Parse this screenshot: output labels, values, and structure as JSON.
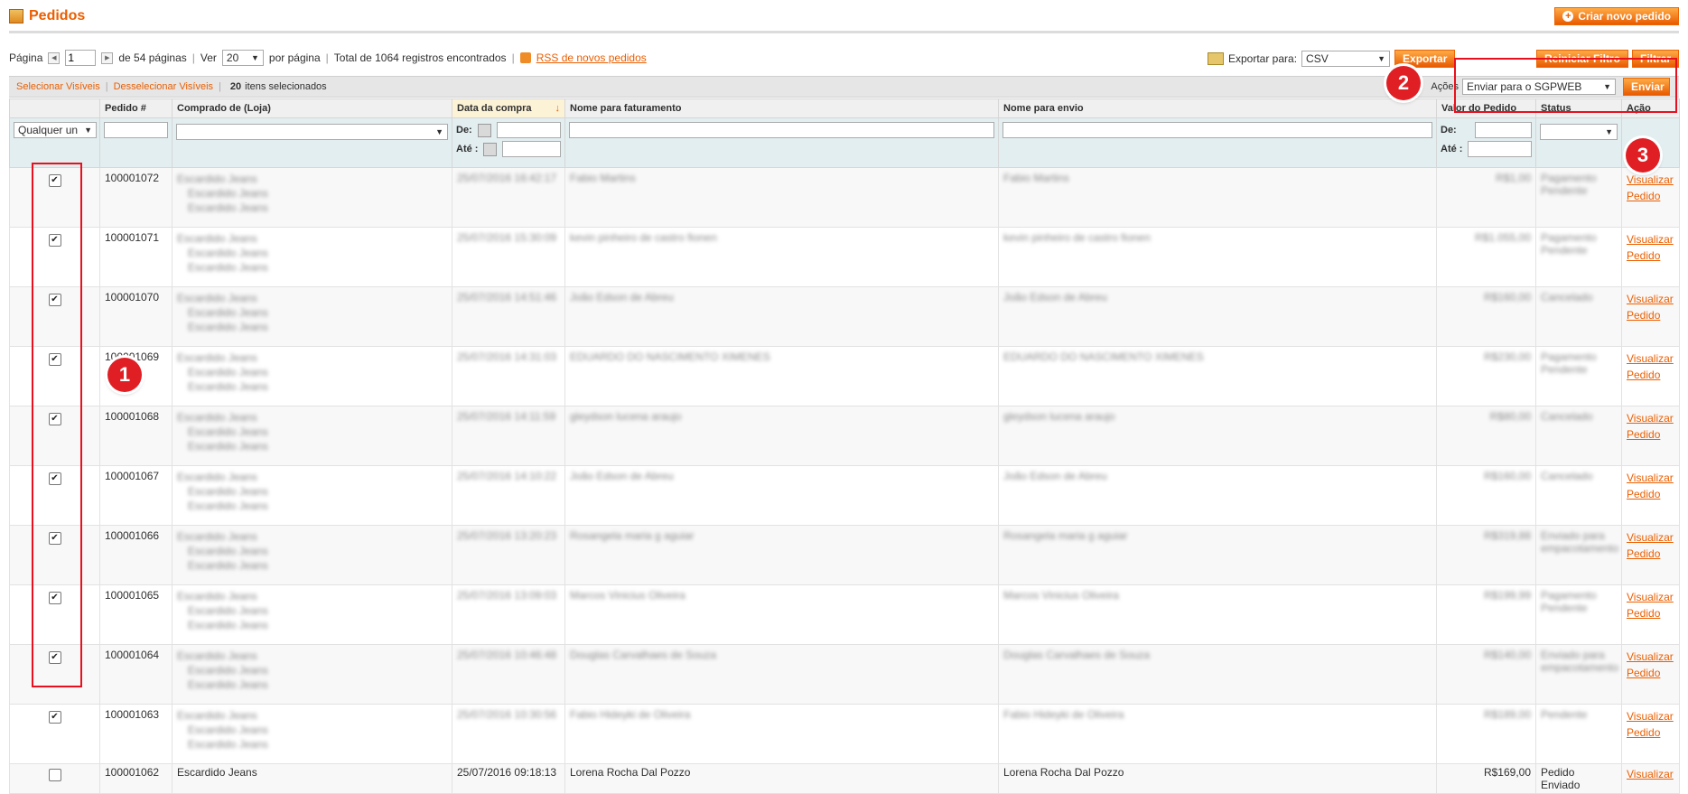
{
  "header": {
    "title": "Pedidos",
    "create_order": "Criar novo pedido"
  },
  "pager": {
    "page_label": "Página",
    "page_value": "1",
    "total_pages": "de 54 páginas",
    "view_label": "Ver",
    "per_page": "20",
    "per_page_suffix": "por página",
    "total": "Total de 1064 registros encontrados",
    "rss": "RSS de novos pedidos"
  },
  "export": {
    "label": "Exportar para:",
    "format": "CSV",
    "button": "Exportar"
  },
  "filters_buttons": {
    "reset": "Reiniciar Filtro",
    "search": "Filtrar"
  },
  "massaction": {
    "select_visible": "Selecionar Visíveis",
    "deselect_visible": "Desselecionar Visíveis",
    "selected_count": "20",
    "selected_suffix": "itens selecionados",
    "actions_label": "Ações",
    "action_value": "Enviar para o SGPWEB",
    "submit": "Enviar"
  },
  "columns": [
    "Pedido #",
    "Comprado de (Loja)",
    "Data da compra",
    "Nome para faturamento",
    "Nome para envio",
    "Valor do Pedido",
    "Status",
    "Ação"
  ],
  "filters": {
    "any": "Qualquer un",
    "from": "De:",
    "to": "Até :"
  },
  "badges": [
    "1",
    "2",
    "3"
  ],
  "rows": [
    {
      "id": "100001072",
      "store": [
        "Escardido Jeans",
        "Escardido Jeans",
        "Escardido Jeans"
      ],
      "date": "25/07/2016 16:42:17",
      "bill": "Fabio Martins",
      "ship": "Fabio Martins",
      "value": "R$1,00",
      "status": "Pagamento Pendente",
      "action": [
        "Visualizar",
        "Pedido"
      ]
    },
    {
      "id": "100001071",
      "store": [
        "Escardido Jeans",
        "Escardido Jeans",
        "Escardido Jeans"
      ],
      "date": "25/07/2016 15:30:09",
      "bill": "kevin pinheiro de castro fionen",
      "ship": "kevin pinheiro de castro fionen",
      "value": "R$1.055,00",
      "status": "Pagamento Pendente",
      "action": [
        "Visualizar",
        "Pedido"
      ]
    },
    {
      "id": "100001070",
      "store": [
        "Escardido Jeans",
        "Escardido Jeans",
        "Escardido Jeans"
      ],
      "date": "25/07/2016 14:51:46",
      "bill": "João Edson de Abreu",
      "ship": "João Edson de Abreu",
      "value": "R$160,00",
      "status": "Cancelado",
      "action": [
        "Visualizar",
        "Pedido"
      ]
    },
    {
      "id": "100001069",
      "store": [
        "Escardido Jeans",
        "Escardido Jeans",
        "Escardido Jeans"
      ],
      "date": "25/07/2016 14:31:03",
      "bill": "EDUARDO DO NASCIMENTO XIMENES",
      "ship": "EDUARDO DO NASCIMENTO XIMENES",
      "value": "R$230,00",
      "status": "Pagamento Pendente",
      "action": [
        "Visualizar",
        "Pedido"
      ]
    },
    {
      "id": "100001068",
      "store": [
        "Escardido Jeans",
        "Escardido Jeans",
        "Escardido Jeans"
      ],
      "date": "25/07/2016 14:11:59",
      "bill": "gleydson lucena araujo",
      "ship": "gleydson lucena araujo",
      "value": "R$80,00",
      "status": "Cancelado",
      "action": [
        "Visualizar",
        "Pedido"
      ]
    },
    {
      "id": "100001067",
      "store": [
        "Escardido Jeans",
        "Escardido Jeans",
        "Escardido Jeans"
      ],
      "date": "25/07/2016 14:10:22",
      "bill": "João Edson de Abreu",
      "ship": "João Edson de Abreu",
      "value": "R$160,00",
      "status": "Cancelado",
      "action": [
        "Visualizar",
        "Pedido"
      ]
    },
    {
      "id": "100001066",
      "store": [
        "Escardido Jeans",
        "Escardido Jeans",
        "Escardido Jeans"
      ],
      "date": "25/07/2016 13:20:23",
      "bill": "Rosangela maria g aguiar",
      "ship": "Rosangela maria g aguiar",
      "value": "R$319,88",
      "status": "Enviado para empacotamento",
      "action": [
        "Visualizar",
        "Pedido"
      ]
    },
    {
      "id": "100001065",
      "store": [
        "Escardido Jeans",
        "Escardido Jeans",
        "Escardido Jeans"
      ],
      "date": "25/07/2016 13:09:03",
      "bill": "Marcos Vinicius Oliveira",
      "ship": "Marcos Vinicius Oliveira",
      "value": "R$199,99",
      "status": "Pagamento Pendente",
      "action": [
        "Visualizar",
        "Pedido"
      ]
    },
    {
      "id": "100001064",
      "store": [
        "Escardido Jeans",
        "Escardido Jeans",
        "Escardido Jeans"
      ],
      "date": "25/07/2016 10:46:48",
      "bill": "Douglas Carvalhaes de Souza",
      "ship": "Douglas Carvalhaes de Souza",
      "value": "R$140,00",
      "status": "Enviado para empacotamento",
      "action": [
        "Visualizar",
        "Pedido"
      ]
    },
    {
      "id": "100001063",
      "store": [
        "Escardido Jeans",
        "Escardido Jeans",
        "Escardido Jeans"
      ],
      "date": "25/07/2016 10:30:56",
      "bill": "Fabio Hideyki de Oliveira",
      "ship": "Fabio Hideyki de Oliveira",
      "value": "R$189,00",
      "status": "Pendente",
      "action": [
        "Visualizar",
        "Pedido"
      ]
    }
  ],
  "partial_row": {
    "id": "100001062",
    "store": "Escardido Jeans",
    "date": "25/07/2016 09:18:13",
    "bill": "Lorena Rocha Dal Pozzo",
    "ship": "Lorena Rocha Dal Pozzo",
    "value": "R$169,00",
    "status": "Pedido Enviado",
    "action": "Visualizar"
  }
}
